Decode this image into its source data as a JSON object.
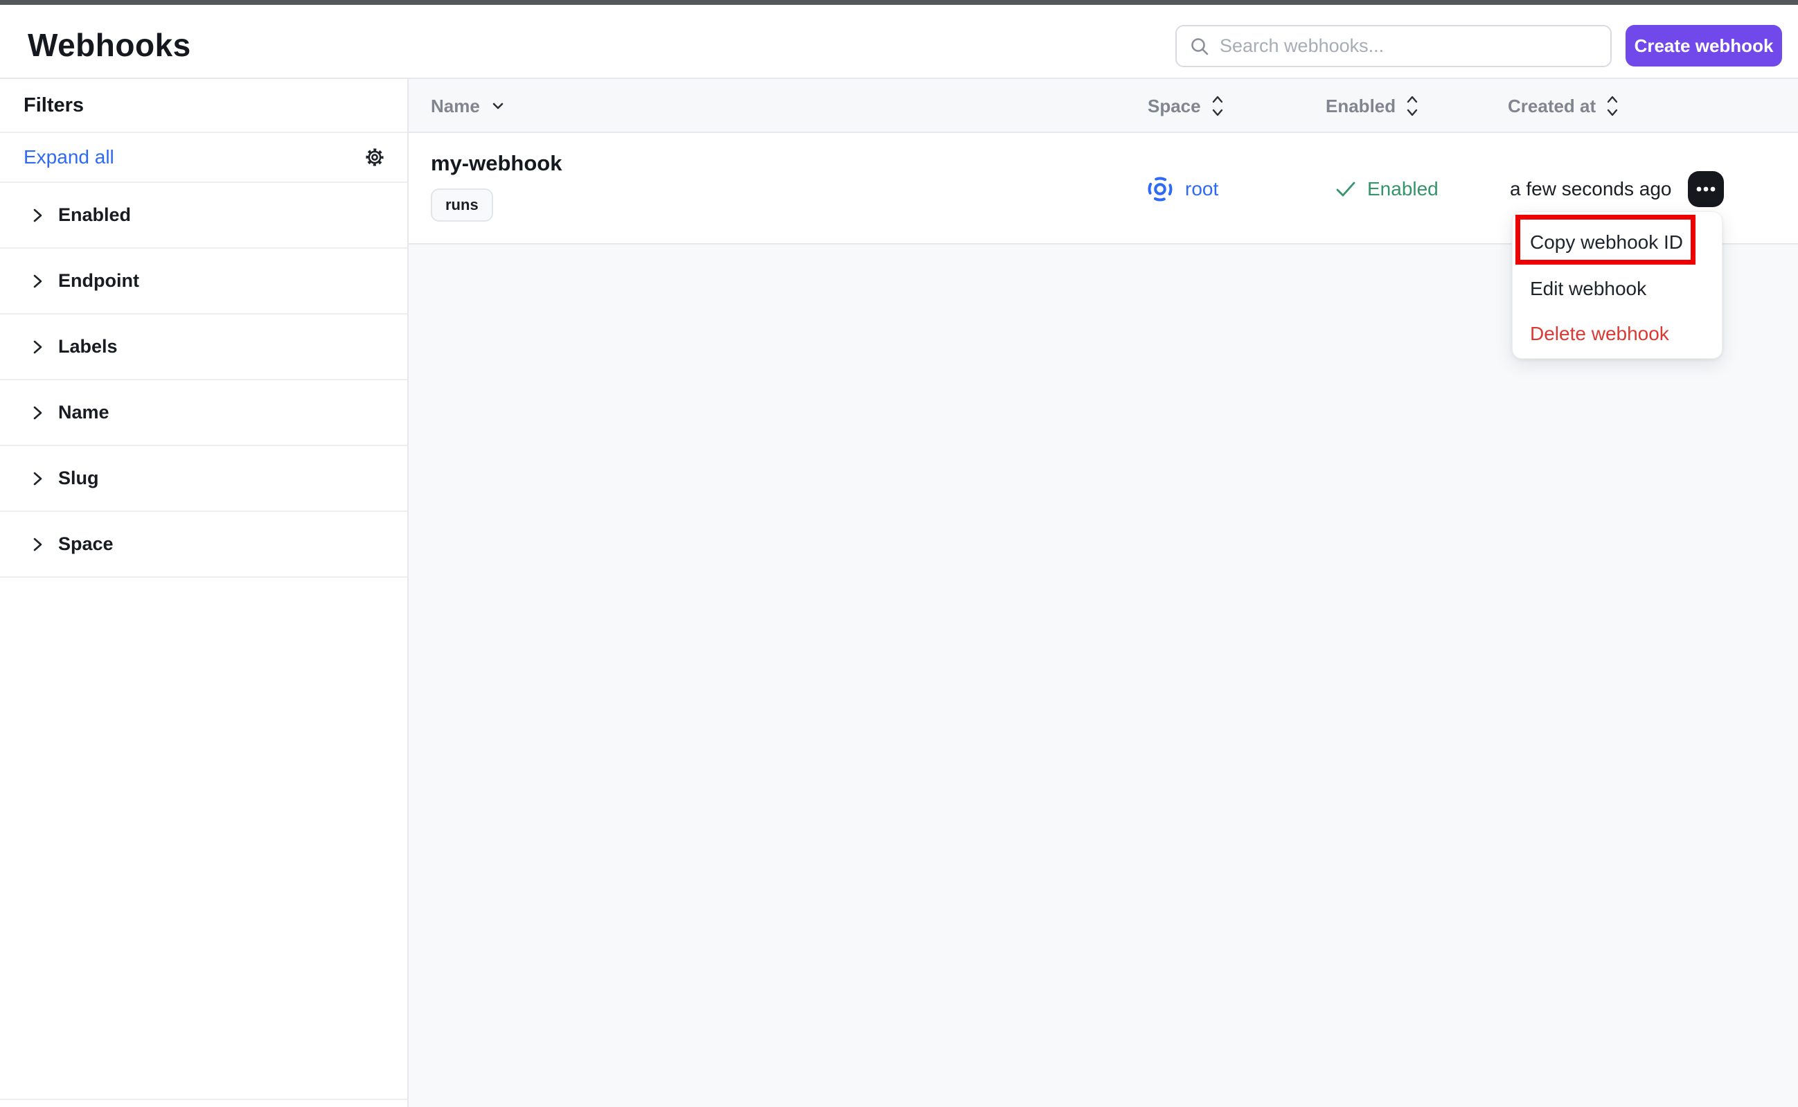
{
  "header": {
    "title": "Webhooks",
    "search_placeholder": "Search webhooks...",
    "create_button": "Create webhook"
  },
  "sidebar": {
    "title": "Filters",
    "expand_all": "Expand all",
    "sections": [
      {
        "label": "Enabled"
      },
      {
        "label": "Endpoint"
      },
      {
        "label": "Labels"
      },
      {
        "label": "Name"
      },
      {
        "label": "Slug"
      },
      {
        "label": "Space"
      }
    ]
  },
  "table": {
    "columns": [
      {
        "label": "Name",
        "sort_icon": "chevron-down"
      },
      {
        "label": "Space",
        "sort_icon": "sort-updown"
      },
      {
        "label": "Enabled",
        "sort_icon": "sort-updown"
      },
      {
        "label": "Created at",
        "sort_icon": "sort-updown"
      }
    ],
    "rows": [
      {
        "name": "my-webhook",
        "tag": "runs",
        "space": "root",
        "enabled": "Enabled",
        "created_at": "a few seconds ago"
      }
    ]
  },
  "menu": {
    "items": [
      {
        "label": "Copy webhook ID",
        "highlighted": true
      },
      {
        "label": "Edit webhook"
      },
      {
        "label": "Delete webhook",
        "danger": true
      }
    ]
  },
  "icons": {
    "search": "magnifier",
    "gear": "settings-cog",
    "chevron_right": "›",
    "chevron_down": "⌄",
    "sort": "⌃⌄",
    "check": "✓",
    "space_target": "dashed-circle-dot",
    "ellipsis": "•••"
  },
  "colors": {
    "accent_purple": "#7148ea",
    "link_blue": "#2f6af5",
    "success_green": "#35946b",
    "danger_red": "#da3a33",
    "annotation_red": "#ee0000",
    "topbar_gray": "#56575b",
    "page_bg": "#f8f9fb",
    "border": "#e6e8ec"
  }
}
